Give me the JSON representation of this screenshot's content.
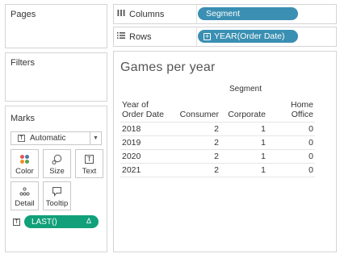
{
  "cards": {
    "pages": "Pages",
    "filters": "Filters",
    "marks": "Marks"
  },
  "marks": {
    "type": "Automatic",
    "buttons": {
      "color": "Color",
      "size": "Size",
      "text": "Text",
      "detail": "Detail",
      "tooltip": "Tooltip"
    },
    "pill": "LAST()",
    "pill_delta": "Δ"
  },
  "shelves": {
    "columns_label": "Columns",
    "columns_pill": "Segment",
    "rows_label": "Rows",
    "rows_pill": "YEAR(Order Date)"
  },
  "view": {
    "title": "Games per year",
    "column_group": "Segment",
    "row_header_line1": "Year of",
    "row_header_line2": "Order Date",
    "columns": [
      "Consumer",
      "Corporate",
      "Home",
      "Office"
    ],
    "rows": [
      {
        "year": "2018",
        "consumer": "2",
        "corporate": "1",
        "home_office": "0"
      },
      {
        "year": "2019",
        "consumer": "2",
        "corporate": "1",
        "home_office": "0"
      },
      {
        "year": "2020",
        "consumer": "2",
        "corporate": "1",
        "home_office": "0"
      },
      {
        "year": "2021",
        "consumer": "2",
        "corporate": "1",
        "home_office": "0"
      }
    ]
  },
  "colors": {
    "shelf_pill": "#3a8fb2",
    "calc_pill": "#11a07a"
  }
}
